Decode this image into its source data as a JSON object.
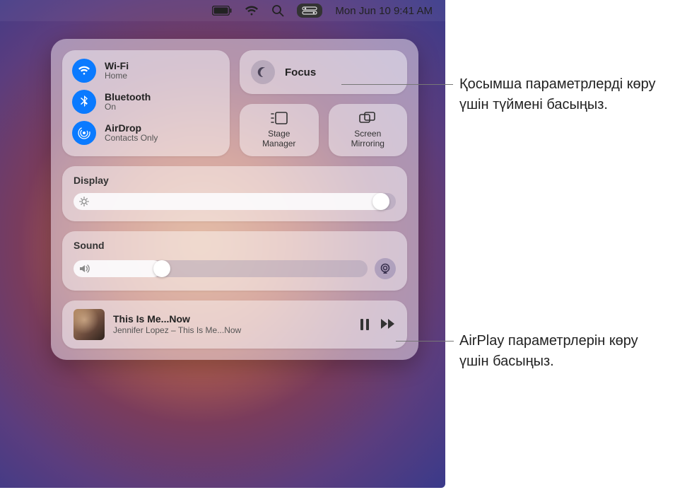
{
  "menubar": {
    "date_time": "Mon Jun 10  9:41 AM"
  },
  "connectivity": {
    "wifi": {
      "title": "Wi-Fi",
      "subtitle": "Home"
    },
    "bluetooth": {
      "title": "Bluetooth",
      "subtitle": "On"
    },
    "airdrop": {
      "title": "AirDrop",
      "subtitle": "Contacts Only"
    }
  },
  "focus": {
    "title": "Focus"
  },
  "tiles": {
    "stage_manager": "Stage\nManager",
    "screen_mirroring": "Screen\nMirroring"
  },
  "display": {
    "title": "Display",
    "brightness_pct": 98
  },
  "sound": {
    "title": "Sound",
    "volume_pct": 30
  },
  "now_playing": {
    "title": "This Is Me...Now",
    "subtitle": "Jennifer Lopez – This Is Me...Now"
  },
  "callouts": {
    "focus": "Қосымша параметрлерді көру үшін түймені басыңыз.",
    "airplay": "AirPlay параметрлерін көру үшін басыңыз."
  }
}
